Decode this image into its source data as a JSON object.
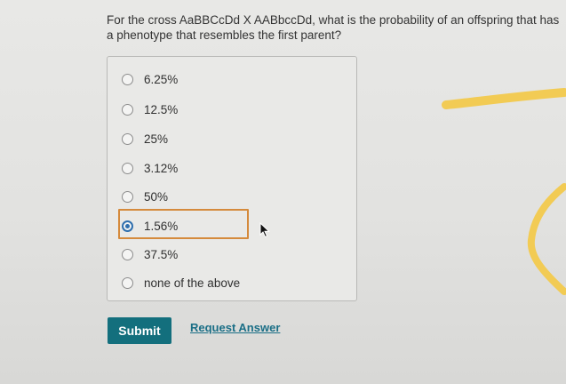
{
  "question": {
    "text": "For the cross AaBBCcDd X AABbccDd, what is the probability of an offspring that has a phenotype that resembles the first parent?"
  },
  "options": [
    {
      "label": "6.25%",
      "selected": false
    },
    {
      "label": "12.5%",
      "selected": false
    },
    {
      "label": "25%",
      "selected": false
    },
    {
      "label": "3.12%",
      "selected": false
    },
    {
      "label": "50%",
      "selected": false
    },
    {
      "label": "1.56%",
      "selected": true
    },
    {
      "label": "37.5%",
      "selected": false
    },
    {
      "label": "none of the above",
      "selected": false
    }
  ],
  "actions": {
    "submit_label": "Submit",
    "request_answer_label": "Request Answer"
  },
  "colors": {
    "submit_bg": "#136f7d",
    "link": "#1a6e86",
    "selection_outline": "#d58a3c",
    "radio_checked": "#2f6fae",
    "highlighter_marks": "#f2c94c"
  },
  "icons": {
    "cursor": "mouse-pointer-icon"
  }
}
